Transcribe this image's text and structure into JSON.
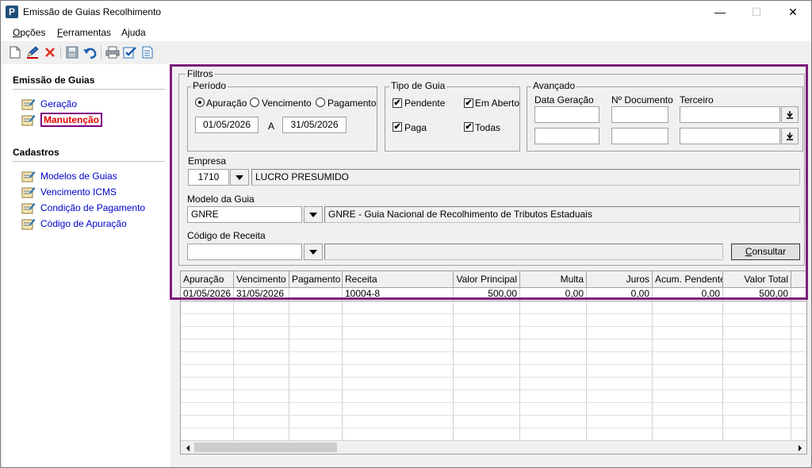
{
  "window": {
    "title": "Emissão de Guias Recolhimento",
    "app_icon_letter": "P",
    "minimize": "—",
    "maximize": "☐",
    "close": "✕"
  },
  "menu": {
    "opcoes_pre": "",
    "opcoes_u": "O",
    "opcoes_post": "pções",
    "ferramentas_u": "F",
    "ferramentas_post": "erramentas",
    "ajuda_pre": "A",
    "ajuda_u": "j",
    "ajuda_post": "uda"
  },
  "toolbar": {
    "icons": [
      "new-document-icon",
      "edit-pencil-icon",
      "delete-x-icon",
      "save-disk-icon",
      "undo-icon",
      "print-icon",
      "approve-check-icon",
      "report-icon"
    ]
  },
  "nav": {
    "section1_title": "Emissão de Guias",
    "section1_items": [
      "Geração",
      "Manutenção"
    ],
    "selected_item": "Manutenção",
    "section2_title": "Cadastros",
    "section2_items": [
      "Modelos de Guias",
      "Vencimento ICMS",
      "Condição de Pagamento",
      "Código de Apuração"
    ]
  },
  "filtros": {
    "title": "Filtros",
    "periodo": {
      "title": "Período",
      "options": [
        "Apuração",
        "Vencimento",
        "Pagamento"
      ],
      "selected": "Apuração",
      "date_from": "01/05/2026",
      "separator": "A",
      "date_to": "31/05/2026"
    },
    "tipo_guia": {
      "title": "Tipo de Guia",
      "pendente": "Pendente",
      "em_aberto": "Em Aberto",
      "paga": "Paga",
      "todas": "Todas",
      "checked_mark": "✔"
    },
    "avancado": {
      "title": "Avançado",
      "data_geracao": "Data Geração",
      "n_documento": "Nº Documento",
      "terceiro": "Terceiro"
    },
    "empresa": {
      "label": "Empresa",
      "code": "1710",
      "name": "LUCRO PRESUMIDO"
    },
    "modelo_guia": {
      "label": "Modelo da Guia",
      "code": "GNRE",
      "name": "GNRE - Guia Nacional de Recolhimento de Tributos Estaduais"
    },
    "codigo_receita": {
      "label": "Código de Receita",
      "code": "",
      "name": ""
    },
    "consultar_u": "C",
    "consultar_post": "onsultar"
  },
  "grid": {
    "columns": [
      "Apuração",
      "Vencimento",
      "Pagamento",
      "Receita",
      "Valor Principal",
      "Multa",
      "Juros",
      "Acum. Pendente",
      "Valor Total"
    ],
    "rows": [
      [
        "01/05/2026",
        "31/05/2026",
        "",
        "10004-8",
        "500,00",
        "0,00",
        "0,00",
        "0,00",
        "500,00"
      ]
    ]
  },
  "colors": {
    "highlight_border": "#7b1e7a",
    "selected_nav_text": "#e00000",
    "nav_link": "#0000cc"
  }
}
